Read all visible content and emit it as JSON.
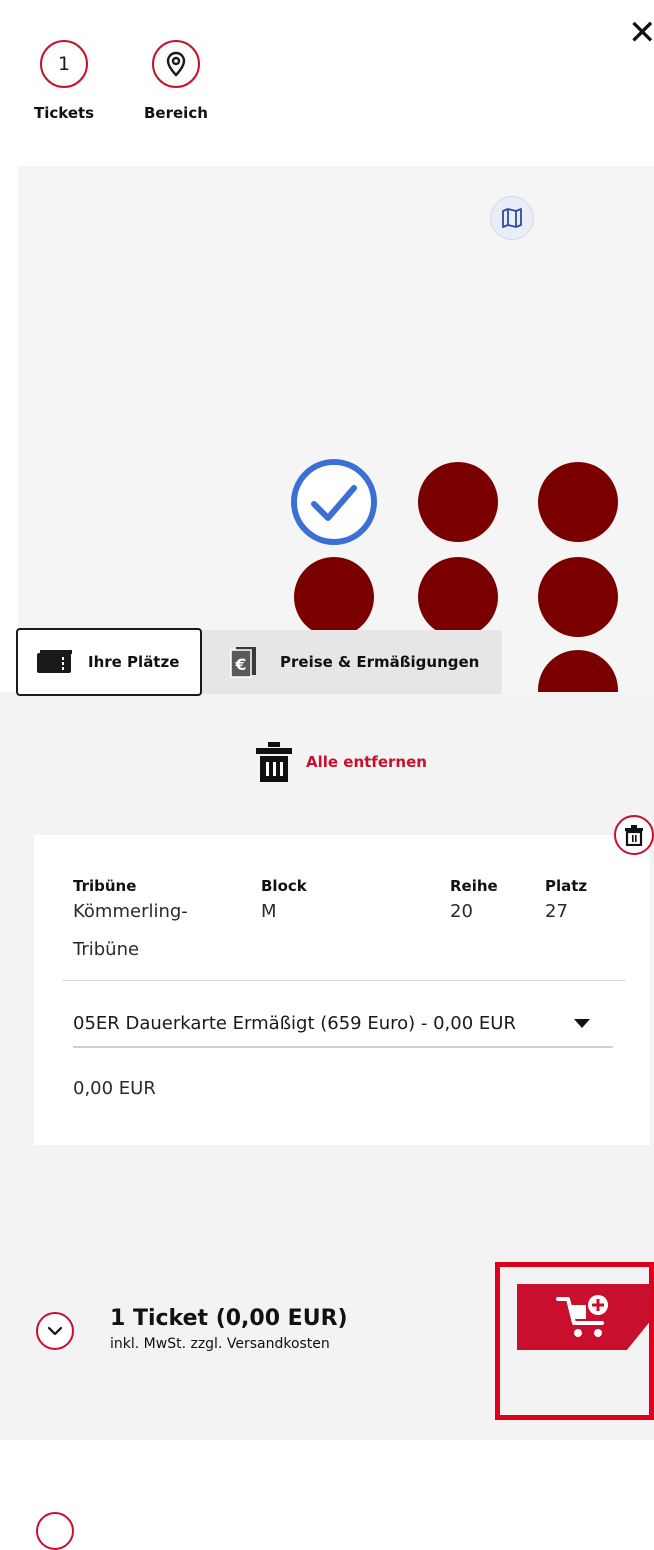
{
  "steps": [
    {
      "number": "1",
      "label": "Tickets"
    },
    {
      "label": "Bereich"
    }
  ],
  "tabs": {
    "your_seats": "Ihre Plätze",
    "prices": "Preise & Ermäßigungen"
  },
  "actions": {
    "remove_all": "Alle entfernen"
  },
  "ticket": {
    "headers": {
      "stand": "Tribüne",
      "block": "Block",
      "row": "Reihe",
      "seat": "Platz"
    },
    "values": {
      "stand_line1": "Kömmerling-",
      "stand_line2": "Tribüne",
      "block": "M",
      "row": "20",
      "seat": "27"
    },
    "price_option": "05ER Dauerkarte Ermäßigt (659 Euro) - 0,00 EUR",
    "price": "0,00 EUR"
  },
  "summary": {
    "title": "1 Ticket (0,00 EUR)",
    "subtitle": "inkl. MwSt. zzgl. Versandkosten"
  },
  "icons": {
    "close": "close-icon",
    "location": "location-pin-icon",
    "map": "map-icon",
    "check": "checkmark-icon",
    "ticket": "ticket-icon",
    "euro": "euro-icon",
    "trash": "trash-icon",
    "chevron": "chevron-down-icon",
    "cart": "add-to-cart-icon"
  },
  "colors": {
    "accent": "#c8102e",
    "seat_taken": "#7a0000",
    "seat_selected": "#3b6fd4",
    "highlight_frame": "#e0001b"
  }
}
